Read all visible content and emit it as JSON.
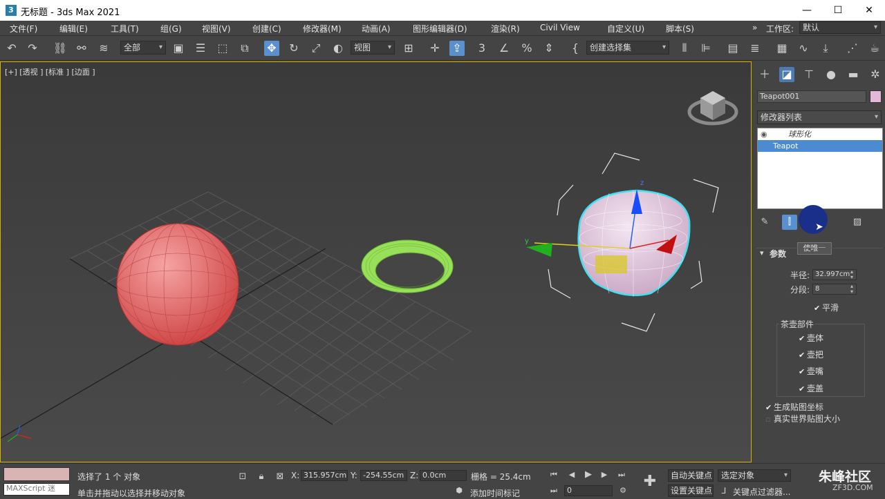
{
  "window": {
    "title": "无标题 - 3ds Max 2021",
    "logo": "3",
    "minimize": "—",
    "maximize": "☐",
    "close": "✕"
  },
  "menu": {
    "items": [
      "文件(F)",
      "编辑(E)",
      "工具(T)",
      "组(G)",
      "视图(V)",
      "创建(C)",
      "修改器(M)",
      "动画(A)",
      "图形编辑器(D)",
      "渲染(R)",
      "Civil View",
      "自定义(U)",
      "脚本(S)"
    ],
    "overflow": "»",
    "workspace_label": "工作区:",
    "workspace_value": "默认"
  },
  "toolbar": {
    "selection_filter": "全部",
    "coord_system": "视图",
    "named_selection": "创建选择集"
  },
  "viewport": {
    "label": "[+] [透视 ] [标准 ] [边面 ]",
    "gizmo_y": "y",
    "gizmo_z": "z"
  },
  "command_panel": {
    "object_name": "Teapot001",
    "object_color": "#e6b8d8",
    "modifier_list": "修改器列表",
    "stack": [
      {
        "label": "球形化",
        "selected": false
      },
      {
        "label": "Teapot",
        "selected": true
      }
    ],
    "tooltip": "使唯一",
    "rollout_title": "参数",
    "radius_label": "半径:",
    "radius_value": "32.997cm",
    "segments_label": "分段:",
    "segments_value": "8",
    "smooth_label": "平滑",
    "parts_group": "茶壶部件",
    "parts": [
      "壶体",
      "壶把",
      "壶嘴",
      "壶盖"
    ],
    "gen_mapping": "生成贴图坐标",
    "real_world": "真实世界贴图大小"
  },
  "status": {
    "maxscript": "MAXScript 迷",
    "selected_text": "选择了 1 个 对象",
    "prompt_text": "单击并拖动以选择并移动对象",
    "x_label": "X:",
    "x_value": "315.957cm",
    "y_label": "Y:",
    "y_value": "-254.55cm",
    "z_label": "Z:",
    "z_value": "0.0cm",
    "grid_text": "栅格 = 25.4cm",
    "add_time_tag": "添加时间标记",
    "frame_value": "0",
    "auto_key": "自动关键点",
    "set_key": "设置关键点",
    "selected_object": "选定对象",
    "key_filter": "关键点过滤器...",
    "watermark": "朱峰社区",
    "watermark_url": "ZF3D.COM"
  }
}
